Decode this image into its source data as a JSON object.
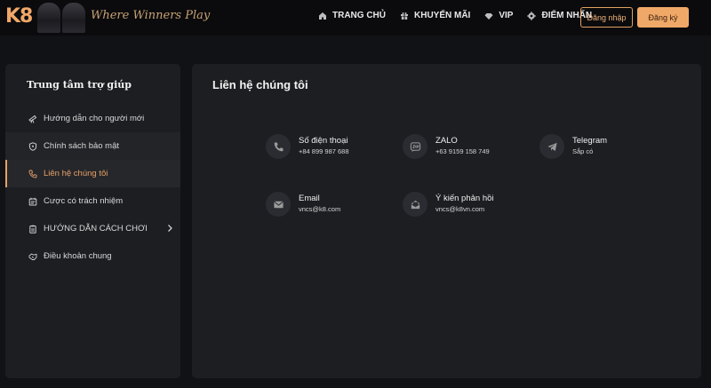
{
  "header": {
    "logo_text": "K8",
    "tagline": "Where Winners Play",
    "nav": [
      {
        "label": "TRANG CHỦ",
        "icon": "home-icon"
      },
      {
        "label": "KHUYẾN MÃI",
        "icon": "gift-icon"
      },
      {
        "label": "VIP",
        "icon": "diamond-icon"
      },
      {
        "label": "ĐIỂM NHẤN",
        "icon": "star-gear-icon"
      }
    ],
    "login_label": "Đăng nhập",
    "register_label": "Đăng ký"
  },
  "sidebar": {
    "title": "Trung tâm trợ giúp",
    "items": [
      {
        "label": "Hướng dẫn cho người mới",
        "icon": "telescope-icon"
      },
      {
        "label": "Chính sách bảo mật",
        "icon": "shield-icon"
      },
      {
        "label": "Liên hệ chúng tôi",
        "icon": "phone-icon",
        "active": true
      },
      {
        "label": "Cược có trách nhiệm",
        "icon": "scale-icon"
      },
      {
        "label": "HƯỚNG DẪN CÁCH CHƠI",
        "icon": "clipboard-icon",
        "has_chevron": true
      },
      {
        "label": "Điều khoản chung",
        "icon": "handshake-icon"
      }
    ]
  },
  "main": {
    "title": "Liên hệ chúng tôi",
    "contacts": [
      {
        "label": "Số điện thoại",
        "value": "+84 899 987 688",
        "icon": "phone-icon"
      },
      {
        "label": "ZALO",
        "value": "+63 9159 158 749",
        "icon": "zalo-icon"
      },
      {
        "label": "Telegram",
        "value": "Sắp có",
        "icon": "telegram-icon"
      },
      {
        "label": "Email",
        "value": "vncs@k8.com",
        "icon": "email-icon"
      },
      {
        "label": "Ý kiến phản hồi",
        "value": "vncs@k8vn.com",
        "icon": "feedback-icon"
      }
    ]
  },
  "colors": {
    "accent": "#f0a868",
    "background": "#111215",
    "panel": "#1d1e22"
  }
}
